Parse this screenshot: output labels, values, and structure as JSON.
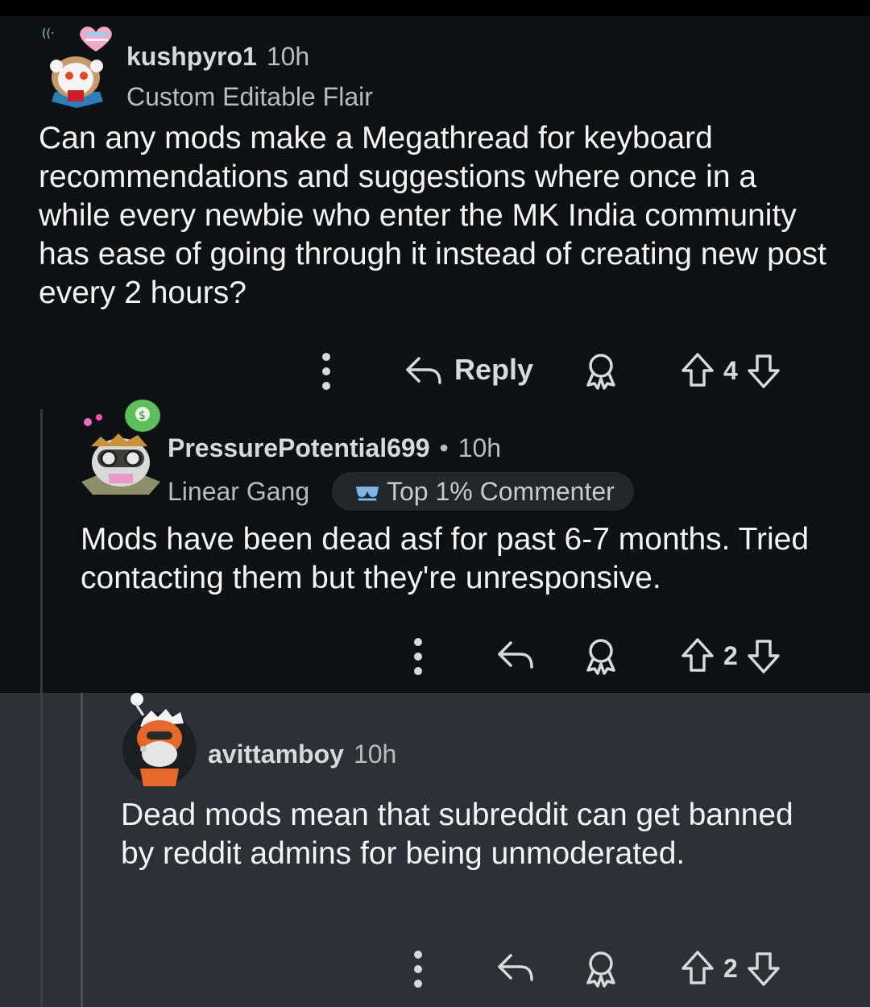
{
  "comments": [
    {
      "username": "kushpyro1",
      "time": "10h",
      "flair": "Custom Editable Flair",
      "body": "Can any mods make a Megathread for keyboard recommendations and suggestions where once in a while every newbie who enter the MK India community has ease of going through it instead of creating new post every 2 hours?",
      "reply_label": "Reply",
      "score": "4"
    },
    {
      "username": "PressurePotential699",
      "separator": "•",
      "time": "10h",
      "flair": "Linear Gang",
      "badge": "Top 1% Commenter",
      "body": "Mods have been dead asf for past 6-7 months. Tried contacting them but they're unresponsive.",
      "score": "2"
    },
    {
      "username": "avittamboy",
      "time": "10h",
      "body": "Dead mods mean that subreddit can get banned by reddit admins for being unmoderated.",
      "score": "2"
    }
  ],
  "icons": {
    "more": "more-vertical-icon",
    "reply": "reply-arrow-icon",
    "award": "award-icon",
    "upvote": "upvote-icon",
    "downvote": "downvote-icon"
  },
  "colors": {
    "background": "#0e1113",
    "highlight": "#2b3136",
    "text": "#f2f4f5",
    "meta": "#b8bcbf"
  }
}
